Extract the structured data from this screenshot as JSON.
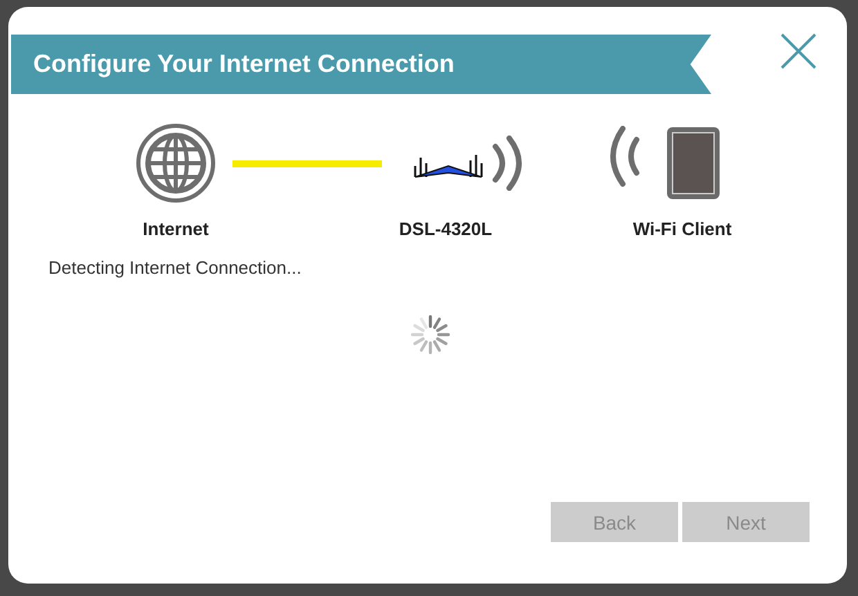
{
  "dialog": {
    "title": "Configure Your Internet Connection"
  },
  "nodes": [
    {
      "kind": "globe",
      "label": "Internet"
    },
    {
      "kind": "router",
      "label": "DSL-4320L"
    },
    {
      "kind": "client",
      "label": "Wi-Fi Client"
    }
  ],
  "status": "Detecting Internet Connection...",
  "buttons": [
    {
      "label": "Back",
      "disabled": true
    },
    {
      "label": "Next",
      "disabled": true
    }
  ]
}
